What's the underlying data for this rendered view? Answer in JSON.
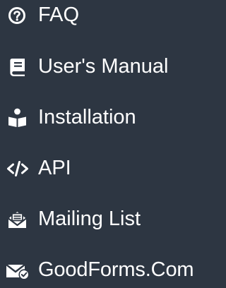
{
  "background": "#2d3642",
  "text_color": "#ffffff",
  "menu": {
    "items": [
      {
        "label": "FAQ",
        "icon": "question-circle-icon"
      },
      {
        "label": "User's Manual",
        "icon": "book-icon"
      },
      {
        "label": "Installation",
        "icon": "book-reader-icon"
      },
      {
        "label": "API",
        "icon": "code-icon"
      },
      {
        "label": "Mailing List",
        "icon": "envelope-open-text-icon"
      },
      {
        "label": "GoodForms.Com",
        "icon": "envelope-check-icon"
      }
    ]
  }
}
